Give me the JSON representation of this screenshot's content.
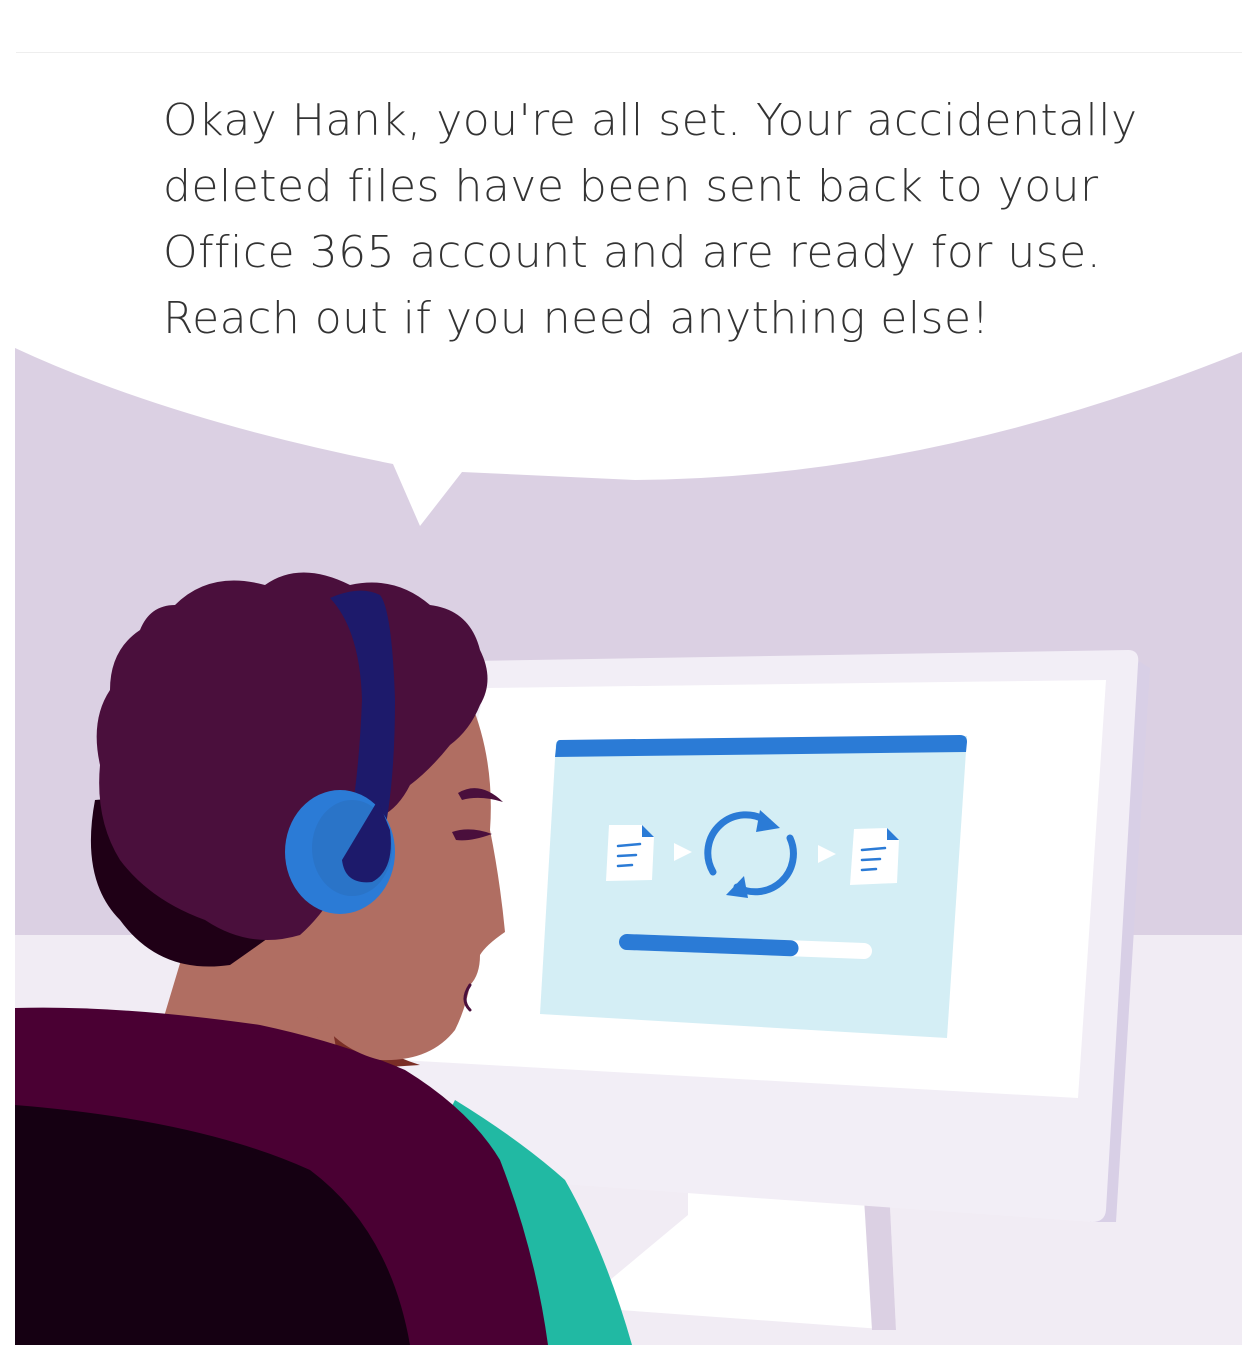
{
  "caption": {
    "text": "Okay Hank, you're all set. Your accidentally\ndeleted files have been sent back to your\nOffice 365 account and are ready for use.\nReach out if you need anything else!"
  },
  "illustration": {
    "icons": [
      "document-icon",
      "arrow-right-icon",
      "refresh-icon"
    ],
    "restore_progress_fraction": 0.69,
    "colors": {
      "wall": "#dbd0e3",
      "floor": "#f1ecf4",
      "accent_blue": "#2b7bd6",
      "screen_light_blue": "#d4eef5",
      "hair": "#4a0f3c",
      "skin": "#b06e62",
      "shirt": "#4a0033",
      "teal": "#21b9a3",
      "headset_band": "#1d1a6b"
    }
  }
}
